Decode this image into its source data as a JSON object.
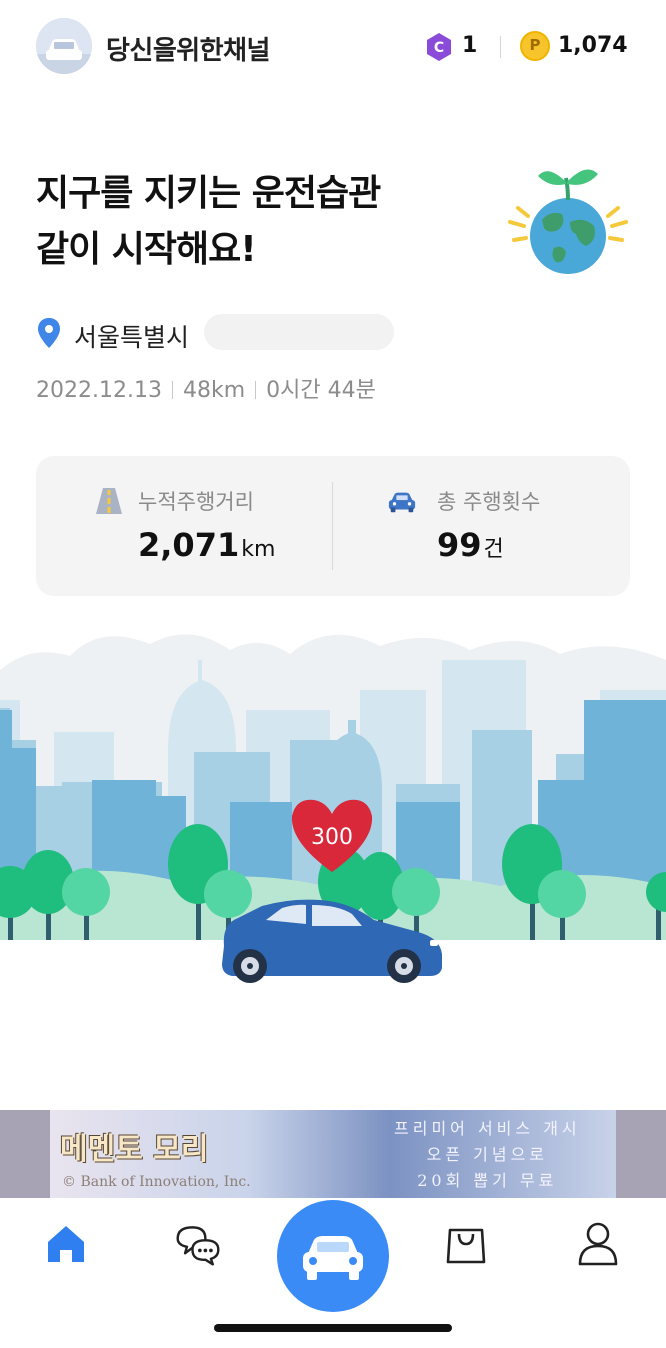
{
  "header": {
    "channel_name": "당신을위한채널",
    "coin_c_symbol": "C",
    "coin_c_count": "1",
    "coin_p_symbol": "P",
    "coin_p_count": "1,074"
  },
  "hero": {
    "headline_line1": "지구를 지키는 운전습관",
    "headline_line2": "같이 시작해요!"
  },
  "trip": {
    "location": "서울특별시",
    "date": "2022.12.13",
    "distance": "48km",
    "duration": "0시간 44분"
  },
  "stats": {
    "total_distance_label": "누적주행거리",
    "total_distance_value": "2,071",
    "total_distance_unit": "km",
    "total_trips_label": "총 주행횟수",
    "total_trips_value": "99",
    "total_trips_unit": "건"
  },
  "scene": {
    "heart_value": "300"
  },
  "ad": {
    "logo": "메멘토 모리",
    "copy": "© Bank of Innovation, Inc.",
    "line1": "프리미어 서비스 개시",
    "line2": "오픈 기념으로",
    "line3": "20회 뽑기 무료"
  },
  "tabs": [
    {
      "icon": "home-icon",
      "active": true
    },
    {
      "icon": "chat-icon",
      "active": false
    },
    {
      "icon": "car-icon",
      "active": false
    },
    {
      "icon": "shopping-bag-icon",
      "active": false
    },
    {
      "icon": "profile-icon",
      "active": false
    }
  ],
  "colors": {
    "accent": "#3a8bf6",
    "active_tab": "#2f7ff0",
    "heart": "#d8283a",
    "car": "#2f68b5"
  }
}
